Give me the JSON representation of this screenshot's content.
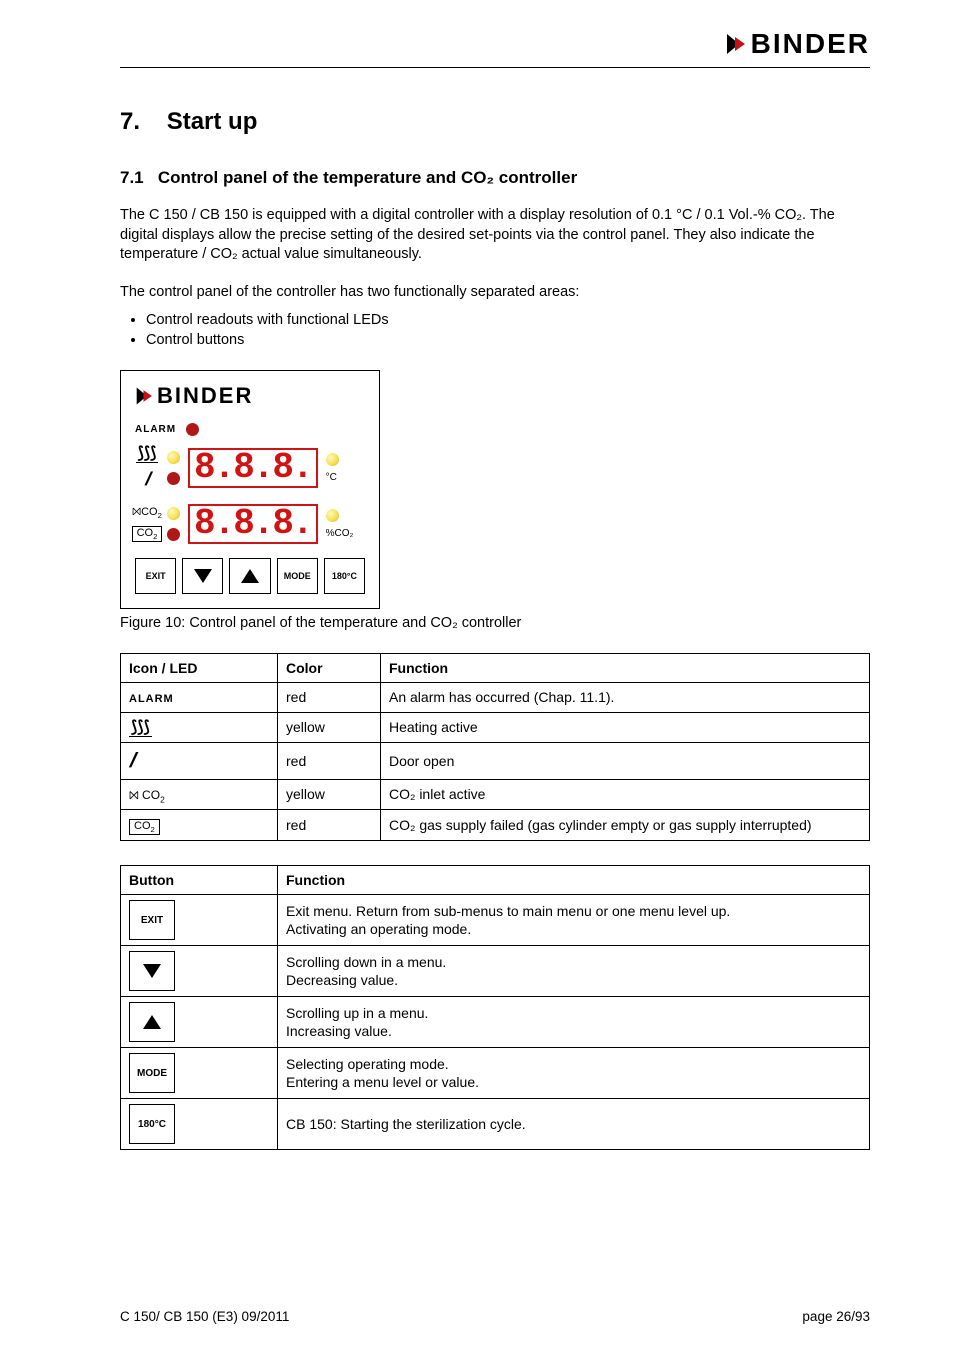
{
  "brand": "BINDER",
  "section": {
    "number": "7.",
    "title": "Start up"
  },
  "subsection": {
    "number": "7.1",
    "title": "Control panel of the temperature and CO₂ controller"
  },
  "intro_p1": "The C 150 / CB 150 is equipped with a digital controller with a display resolution of 0.1 °C / 0.1 Vol.-% CO₂. The digital displays allow the precise setting of the desired set-points via the control panel. They also indicate the temperature / CO₂ actual value simultaneously.",
  "intro_p2": "The control panel of the controller has two functionally separated areas:",
  "bullets": [
    "Control readouts with functional LEDs",
    "Control buttons"
  ],
  "panel": {
    "alarm_label": "ALARM",
    "readout_placeholder": "8.8.8.",
    "unit_temp": "°C",
    "unit_co2": "%CO₂",
    "buttons": {
      "exit": "EXIT",
      "mode": "MODE",
      "steri": "180°C"
    },
    "icon_co2_inlet": "⨝CO₂",
    "icon_co2_inlet_name": "co2-inlet-icon",
    "icon_heating_name": "heating-icon",
    "icon_door_name": "door-icon"
  },
  "figure_caption": "Figure 10: Control panel of the temperature and CO₂ controller",
  "table1": {
    "headers": [
      "Icon / LED",
      "Color",
      "Function"
    ],
    "rows": [
      {
        "icon_label": "ALARM",
        "icon_name": "alarm-text",
        "icon_html": "ALARM",
        "color": "red",
        "func": "An alarm has occurred (Chap. 11.1)."
      },
      {
        "icon_label": "heating",
        "icon_name": "heating-icon",
        "icon_html": "heating-ul",
        "color": "yellow",
        "func": "Heating active"
      },
      {
        "icon_label": "door",
        "icon_name": "door-icon",
        "icon_html": "door-ital",
        "color": "red",
        "func": "Door open"
      },
      {
        "icon_label": "co2-inlet",
        "icon_name": "co2-inlet-icon",
        "icon_html": "co2-inlet",
        "color": "yellow",
        "func": "CO₂ inlet active"
      },
      {
        "icon_label": "co2-box",
        "icon_name": "co2-gas-icon",
        "icon_html": "co2-box",
        "color": "red",
        "func": "CO₂ gas supply failed (gas cylinder empty or gas supply interrupted)"
      }
    ]
  },
  "table2": {
    "headers": [
      "Button",
      "Function"
    ],
    "rows": [
      {
        "btn": "exit",
        "label": "EXIT",
        "func": "Exit menu. Return from sub-menus to main menu or one menu level up.\nActivating an operating mode."
      },
      {
        "btn": "down",
        "label": "down-arrow",
        "func": "Scrolling down in a menu.\nDecreasing value."
      },
      {
        "btn": "up",
        "label": "up-arrow",
        "func": "Scrolling up in a menu.\nIncreasing value."
      },
      {
        "btn": "mode",
        "label": "MODE",
        "func": "Selecting operating mode.\nEntering a menu level or value."
      },
      {
        "btn": "steri",
        "label": "180°C",
        "func": "CB 150: Starting the sterilization cycle."
      }
    ]
  },
  "footer": {
    "left": "C 150/ CB 150 (E3) 09/2011",
    "right": "page 26/93"
  }
}
